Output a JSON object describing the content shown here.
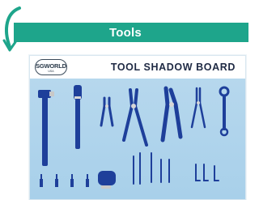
{
  "header": {
    "title": "Tools",
    "accent_color": "#1ea58b",
    "curl_icon": "curved-arrow-icon"
  },
  "board": {
    "title": "TOOL SHADOW BOARD",
    "logo_text": "SGWORLD",
    "logo_sub": "USA",
    "background_color": "#a8d0ea",
    "tool_color": "#1e3f9a",
    "tools": [
      "hammer-icon",
      "screwdriver-icon",
      "pliers-icon",
      "bolt-cutter-icon",
      "multigrip-pliers-icon",
      "needle-nose-pliers-icon",
      "wrench-icon",
      "small-screwdrivers-icon",
      "tape-measure-icon",
      "hex-keys-icon"
    ]
  }
}
